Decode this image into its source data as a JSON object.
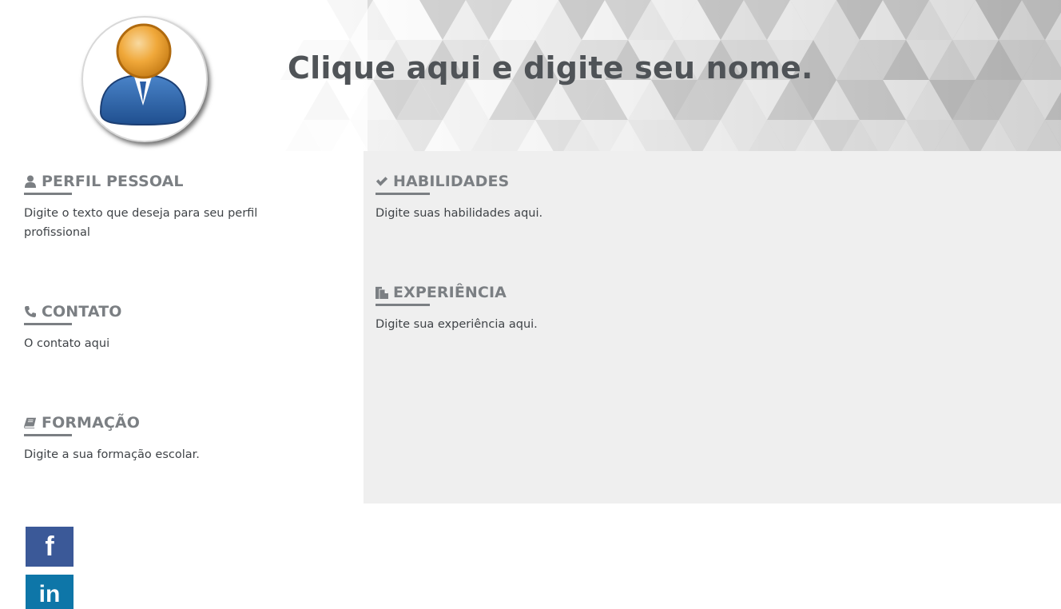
{
  "header": {
    "name": "Clique aqui e digite seu nome."
  },
  "sections": {
    "perfil": {
      "icon": "user-icon",
      "title": "PERFIL PESSOAL",
      "text": "Digite o texto que deseja para seu perfil profissional"
    },
    "contato": {
      "icon": "phone-icon",
      "title": "CONTATO",
      "text": "O contato aqui"
    },
    "formacao": {
      "icon": "book-icon",
      "title": "FORMAÇÃO",
      "text": "Digite a sua formação escolar."
    },
    "habilidades": {
      "icon": "check-icon",
      "title": "HABILIDADES",
      "text": "Digite suas habilidades aqui."
    },
    "experiencia": {
      "icon": "files-icon",
      "title": "EXPERIÊNCIA",
      "text": "Digite sua experiência aqui."
    }
  },
  "social": {
    "facebook": {
      "icon": "facebook-icon",
      "glyph": "f",
      "color": "#3b5998"
    },
    "linkedin": {
      "icon": "linkedin-icon",
      "glyph": "in",
      "color": "#0e76a8"
    }
  },
  "colors": {
    "heading": "#7b7f83",
    "right_panel": "#efefef",
    "name": "#4f5357"
  }
}
